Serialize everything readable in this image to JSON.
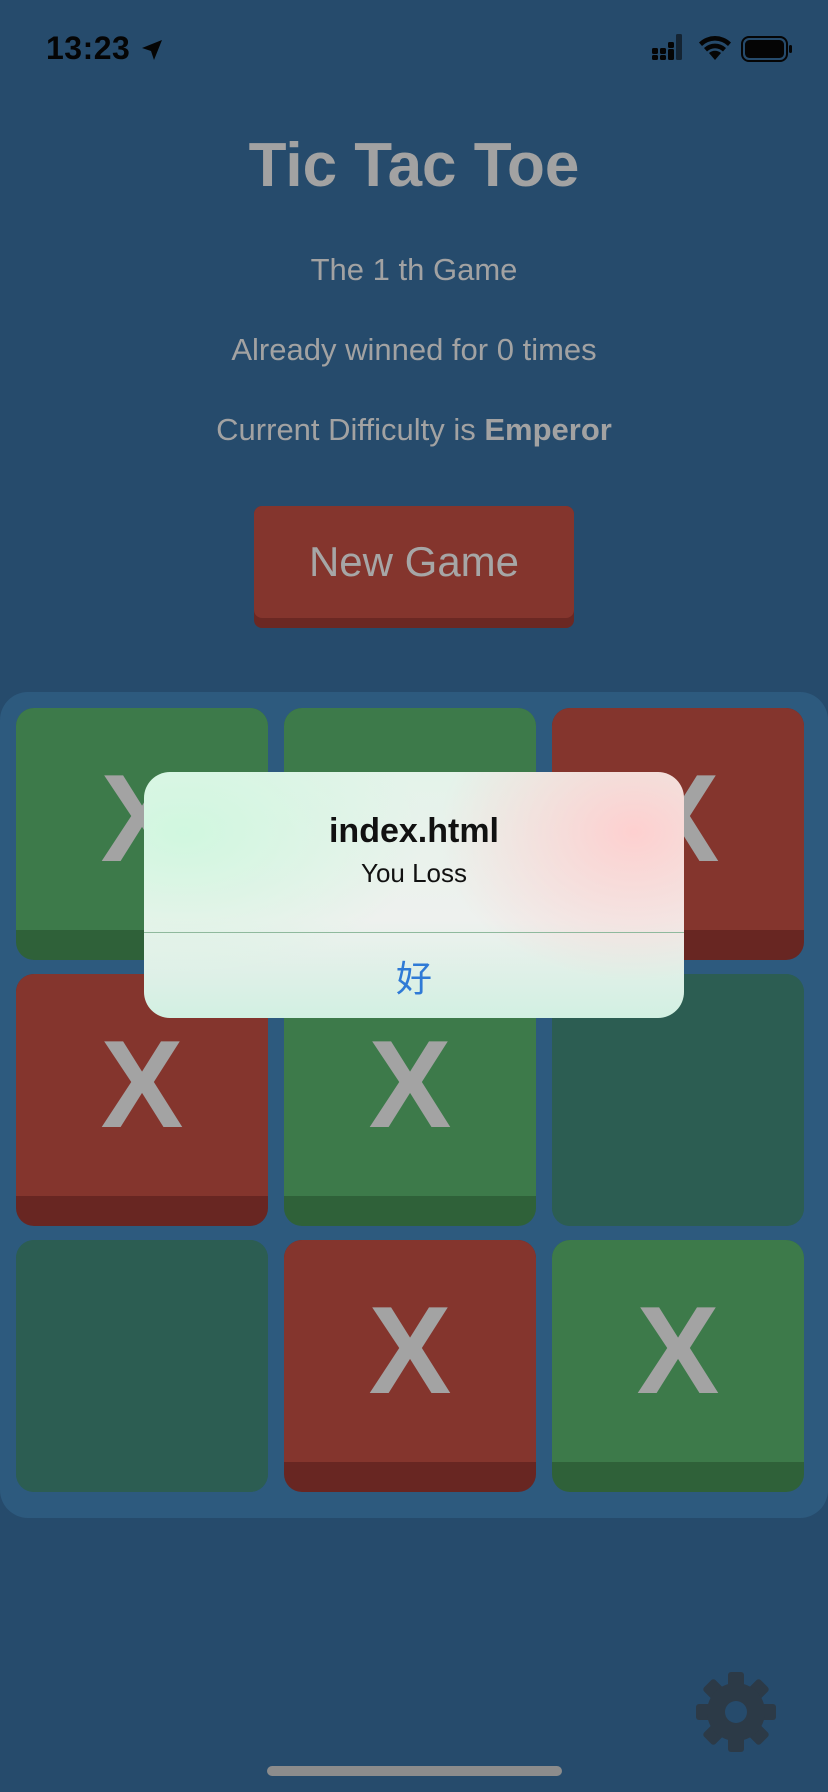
{
  "status_bar": {
    "time": "13:23",
    "icons": [
      "location-arrow-icon",
      "cellular-signal-icon",
      "wifi-icon",
      "battery-icon"
    ]
  },
  "game": {
    "title": "Tic Tac Toe",
    "game_number_text": "The 1 th Game",
    "wins_text": "Already winned for 0 times",
    "difficulty_prefix": "Current Difficulty is ",
    "difficulty_value": "Emperor",
    "new_game_label": "New Game"
  },
  "board": {
    "cells": [
      {
        "mark": "X",
        "color": "green"
      },
      {
        "mark": "",
        "color": "green"
      },
      {
        "mark": "X",
        "color": "red"
      },
      {
        "mark": "X",
        "color": "red"
      },
      {
        "mark": "X",
        "color": "green"
      },
      {
        "mark": "",
        "color": "empty"
      },
      {
        "mark": "",
        "color": "empty"
      },
      {
        "mark": "X",
        "color": "red"
      },
      {
        "mark": "X",
        "color": "green"
      }
    ]
  },
  "alert": {
    "title": "index.html",
    "message": "You Loss",
    "ok_label": "好"
  },
  "footer": {
    "settings_icon": "gear-icon"
  },
  "colors": {
    "background": "#264b6c",
    "board": "#2d5a7e",
    "green_cell": "#3d7a4a",
    "red_cell": "#84352d",
    "empty_cell": "#2c5d52",
    "alert_button_text": "#2f7ad6"
  }
}
